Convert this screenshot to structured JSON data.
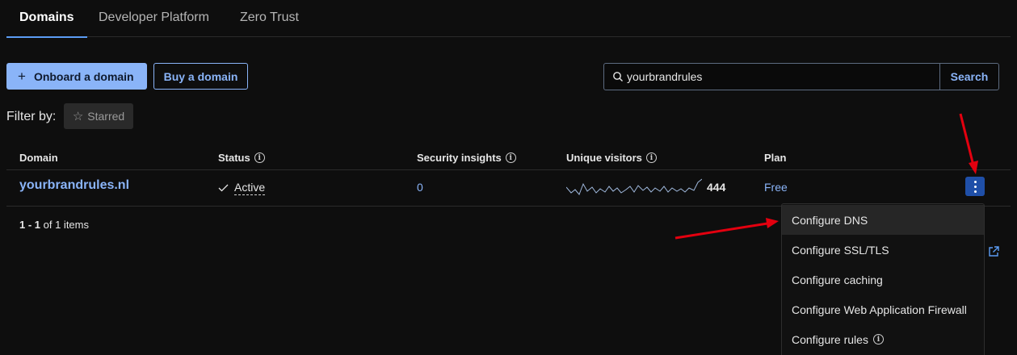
{
  "tabs": [
    {
      "label": "Domains",
      "active": true
    },
    {
      "label": "Developer Platform",
      "active": false
    },
    {
      "label": "Zero Trust",
      "active": false
    }
  ],
  "actions": {
    "onboard_label": "Onboard a domain",
    "onboard_icon": "plus-icon",
    "buy_label": "Buy a domain"
  },
  "search": {
    "value": "yourbrandrules",
    "button_label": "Search",
    "icon": "search-icon"
  },
  "filter": {
    "label": "Filter by:",
    "starred_label": "Starred",
    "starred_icon": "star-icon"
  },
  "table": {
    "columns": [
      "Domain",
      "Status",
      "Security insights",
      "Unique visitors",
      "Plan"
    ],
    "rows": [
      {
        "domain": "yourbrandrules.nl",
        "status": "Active",
        "security_insights": "0",
        "unique_visitors": "444",
        "plan": "Free"
      }
    ],
    "pagination": {
      "range": "1 - 1",
      "suffix": "of 1 items"
    }
  },
  "menu": {
    "items": [
      {
        "label": "Configure DNS",
        "highlighted": true
      },
      {
        "label": "Configure SSL/TLS",
        "highlighted": false
      },
      {
        "label": "Configure caching",
        "highlighted": false
      },
      {
        "label": "Configure Web Application Firewall",
        "highlighted": false
      },
      {
        "label": "Configure rules",
        "highlighted": false,
        "info": true
      }
    ]
  },
  "colors": {
    "background": "#0e0e0e",
    "accent": "#8ab4f8",
    "kebab": "#1f4fa8",
    "annotation_arrow": "#e3000f"
  }
}
